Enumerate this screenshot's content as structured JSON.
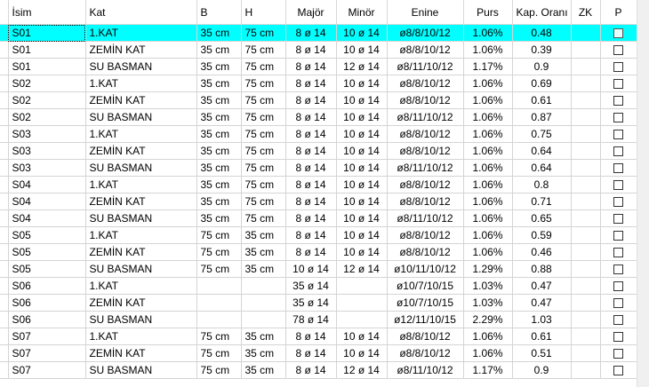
{
  "columns": [
    "İsim",
    "Kat",
    "B",
    "H",
    "Majör",
    "Minör",
    "Enine",
    "Purs",
    "Kap. Oranı",
    "ZK",
    "P"
  ],
  "rows": [
    {
      "isim": "S01",
      "kat": "1.KAT",
      "b": "35 cm",
      "h": "75 cm",
      "major": "8 ø 14",
      "minor": "10 ø 14",
      "enine": "ø8/8/10/12",
      "purs": "1.06%",
      "kap": "0.48",
      "zk": "",
      "selected": true
    },
    {
      "isim": "S01",
      "kat": "ZEMİN KAT",
      "b": "35 cm",
      "h": "75 cm",
      "major": "8 ø 14",
      "minor": "10 ø 14",
      "enine": "ø8/8/10/12",
      "purs": "1.06%",
      "kap": "0.39",
      "zk": ""
    },
    {
      "isim": "S01",
      "kat": "SU BASMAN",
      "b": "35 cm",
      "h": "75 cm",
      "major": "8 ø 14",
      "minor": "12 ø 14",
      "enine": "ø8/11/10/12",
      "purs": "1.17%",
      "kap": "0.9",
      "zk": ""
    },
    {
      "isim": "S02",
      "kat": "1.KAT",
      "b": "35 cm",
      "h": "75 cm",
      "major": "8 ø 14",
      "minor": "10 ø 14",
      "enine": "ø8/8/10/12",
      "purs": "1.06%",
      "kap": "0.69",
      "zk": ""
    },
    {
      "isim": "S02",
      "kat": "ZEMİN KAT",
      "b": "35 cm",
      "h": "75 cm",
      "major": "8 ø 14",
      "minor": "10 ø 14",
      "enine": "ø8/8/10/12",
      "purs": "1.06%",
      "kap": "0.61",
      "zk": ""
    },
    {
      "isim": "S02",
      "kat": "SU BASMAN",
      "b": "35 cm",
      "h": "75 cm",
      "major": "8 ø 14",
      "minor": "10 ø 14",
      "enine": "ø8/11/10/12",
      "purs": "1.06%",
      "kap": "0.87",
      "zk": ""
    },
    {
      "isim": "S03",
      "kat": "1.KAT",
      "b": "35 cm",
      "h": "75 cm",
      "major": "8 ø 14",
      "minor": "10 ø 14",
      "enine": "ø8/8/10/12",
      "purs": "1.06%",
      "kap": "0.75",
      "zk": ""
    },
    {
      "isim": "S03",
      "kat": "ZEMİN KAT",
      "b": "35 cm",
      "h": "75 cm",
      "major": "8 ø 14",
      "minor": "10 ø 14",
      "enine": "ø8/8/10/12",
      "purs": "1.06%",
      "kap": "0.64",
      "zk": ""
    },
    {
      "isim": "S03",
      "kat": "SU BASMAN",
      "b": "35 cm",
      "h": "75 cm",
      "major": "8 ø 14",
      "minor": "10 ø 14",
      "enine": "ø8/11/10/12",
      "purs": "1.06%",
      "kap": "0.64",
      "zk": ""
    },
    {
      "isim": "S04",
      "kat": "1.KAT",
      "b": "35 cm",
      "h": "75 cm",
      "major": "8 ø 14",
      "minor": "10 ø 14",
      "enine": "ø8/8/10/12",
      "purs": "1.06%",
      "kap": "0.8",
      "zk": ""
    },
    {
      "isim": "S04",
      "kat": "ZEMİN KAT",
      "b": "35 cm",
      "h": "75 cm",
      "major": "8 ø 14",
      "minor": "10 ø 14",
      "enine": "ø8/8/10/12",
      "purs": "1.06%",
      "kap": "0.71",
      "zk": ""
    },
    {
      "isim": "S04",
      "kat": "SU BASMAN",
      "b": "35 cm",
      "h": "75 cm",
      "major": "8 ø 14",
      "minor": "10 ø 14",
      "enine": "ø8/11/10/12",
      "purs": "1.06%",
      "kap": "0.65",
      "zk": ""
    },
    {
      "isim": "S05",
      "kat": "1.KAT",
      "b": "75 cm",
      "h": "35 cm",
      "major": "8 ø 14",
      "minor": "10 ø 14",
      "enine": "ø8/8/10/12",
      "purs": "1.06%",
      "kap": "0.59",
      "zk": ""
    },
    {
      "isim": "S05",
      "kat": "ZEMİN KAT",
      "b": "75 cm",
      "h": "35 cm",
      "major": "8 ø 14",
      "minor": "10 ø 14",
      "enine": "ø8/8/10/12",
      "purs": "1.06%",
      "kap": "0.46",
      "zk": ""
    },
    {
      "isim": "S05",
      "kat": "SU BASMAN",
      "b": "75 cm",
      "h": "35 cm",
      "major": "10 ø 14",
      "minor": "12 ø 14",
      "enine": "ø10/11/10/12",
      "purs": "1.29%",
      "kap": "0.88",
      "zk": ""
    },
    {
      "isim": "S06",
      "kat": "1.KAT",
      "b": "",
      "h": "",
      "major": "35 ø 14",
      "minor": "",
      "enine": "ø10/7/10/15",
      "purs": "1.03%",
      "kap": "0.47",
      "zk": ""
    },
    {
      "isim": "S06",
      "kat": "ZEMİN KAT",
      "b": "",
      "h": "",
      "major": "35 ø 14",
      "minor": "",
      "enine": "ø10/7/10/15",
      "purs": "1.03%",
      "kap": "0.47",
      "zk": ""
    },
    {
      "isim": "S06",
      "kat": "SU BASMAN",
      "b": "",
      "h": "",
      "major": "78 ø 14",
      "minor": "",
      "enine": "ø12/11/10/15",
      "purs": "2.29%",
      "kap": "1.03",
      "zk": ""
    },
    {
      "isim": "S07",
      "kat": "1.KAT",
      "b": "75 cm",
      "h": "35 cm",
      "major": "8 ø 14",
      "minor": "10 ø 14",
      "enine": "ø8/8/10/12",
      "purs": "1.06%",
      "kap": "0.61",
      "zk": ""
    },
    {
      "isim": "S07",
      "kat": "ZEMİN KAT",
      "b": "75 cm",
      "h": "35 cm",
      "major": "8 ø 14",
      "minor": "10 ø 14",
      "enine": "ø8/8/10/12",
      "purs": "1.06%",
      "kap": "0.51",
      "zk": ""
    },
    {
      "isim": "S07",
      "kat": "SU BASMAN",
      "b": "75 cm",
      "h": "35 cm",
      "major": "8 ø 14",
      "minor": "12 ø 14",
      "enine": "ø8/11/10/12",
      "purs": "1.17%",
      "kap": "0.9",
      "zk": ""
    }
  ],
  "colors": {
    "selected_row": "#00ffff",
    "grid_line": "#d4d4d4"
  }
}
